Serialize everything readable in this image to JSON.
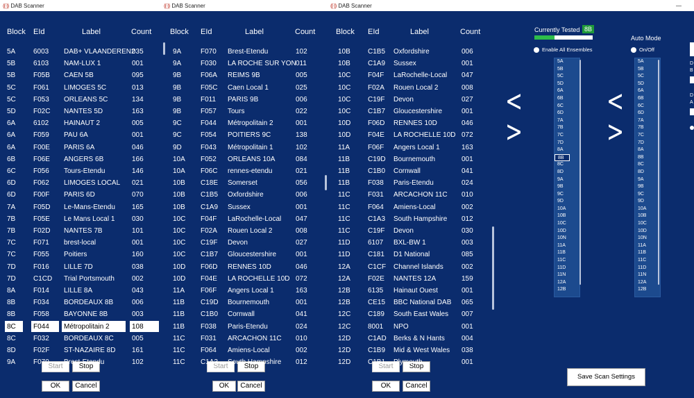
{
  "windows": [
    {
      "title": "DAB Scanner"
    },
    {
      "title": "DAB Scanner"
    },
    {
      "title": "DAB Scanner"
    }
  ],
  "window_minimize": "—",
  "logo_glyph": "((·))",
  "columns": {
    "block": "Block",
    "eid": "EId",
    "label": "Label",
    "count": "Count"
  },
  "panel1": [
    [
      "5A",
      "6003",
      "DAB+ VLAANDEREN2",
      "035"
    ],
    [
      "5B",
      "6103",
      "NAM-LUX 1",
      "001"
    ],
    [
      "5B",
      "F05B",
      "CAEN 5B",
      "095"
    ],
    [
      "5C",
      "F061",
      "LIMOGES 5C",
      "013"
    ],
    [
      "5C",
      "F053",
      "ORLEANS 5C",
      "134"
    ],
    [
      "5D",
      "F02C",
      "NANTES 5D",
      "163"
    ],
    [
      "6A",
      "6102",
      "HAINAUT 2",
      "005"
    ],
    [
      "6A",
      "F059",
      "PAU 6A",
      "001"
    ],
    [
      "6A",
      "F00E",
      "PARIS 6A",
      "046"
    ],
    [
      "6B",
      "F06E",
      "ANGERS 6B",
      "166"
    ],
    [
      "6C",
      "F056",
      "Tours-Etendu",
      "146"
    ],
    [
      "6D",
      "F062",
      "LIMOGES LOCAL",
      "021"
    ],
    [
      "6D",
      "F00F",
      "PARIS 6D",
      "070"
    ],
    [
      "7A",
      "F05D",
      "Le-Mans-Etendu",
      "165"
    ],
    [
      "7B",
      "F05E",
      "Le Mans Local 1",
      "030"
    ],
    [
      "7B",
      "F02D",
      "NANTES 7B",
      "101"
    ],
    [
      "7C",
      "F071",
      "brest-local",
      "001"
    ],
    [
      "7C",
      "F055",
      "Poitiers",
      "160"
    ],
    [
      "7D",
      "F016",
      "LILLE 7D",
      "038"
    ],
    [
      "7D",
      "C1CD",
      "Trial Portsmouth",
      "002"
    ],
    [
      "8A",
      "F014",
      "LILLE 8A",
      "043"
    ],
    [
      "8B",
      "F034",
      "BORDEAUX 8B",
      "006"
    ],
    [
      "8B",
      "F058",
      "BAYONNE 8B",
      "003"
    ],
    [
      "8C",
      "F044",
      "Métropolitain 2",
      "108"
    ],
    [
      "8C",
      "F032",
      "BORDEAUX 8C",
      "005"
    ],
    [
      "8D",
      "F02F",
      "ST-NAZAIRE 8D",
      "161"
    ],
    [
      "9A",
      "F070",
      "Brest-Etendu",
      "102"
    ]
  ],
  "panel2": [
    [
      "9A",
      "F070",
      "Brest-Etendu",
      "102"
    ],
    [
      "9A",
      "F030",
      "LA ROCHE SUR YON",
      "011"
    ],
    [
      "9B",
      "F06A",
      "REIMS 9B",
      "005"
    ],
    [
      "9B",
      "F05C",
      "Caen Local 1",
      "025"
    ],
    [
      "9B",
      "F011",
      "PARIS 9B",
      "006"
    ],
    [
      "9B",
      "F057",
      "Tours",
      "022"
    ],
    [
      "9C",
      "F044",
      "Métropolitain 2",
      "001"
    ],
    [
      "9C",
      "F054",
      "POITIERS 9C",
      "138"
    ],
    [
      "9D",
      "F043",
      "Métropolitain 1",
      "102"
    ],
    [
      "10A",
      "F052",
      "ORLEANS 10A",
      "084"
    ],
    [
      "10A",
      "F06C",
      "rennes-etendu",
      "021"
    ],
    [
      "10B",
      "C18E",
      "Somerset",
      "056"
    ],
    [
      "10B",
      "C1B5",
      "Oxfordshire",
      "006"
    ],
    [
      "10B",
      "C1A9",
      "Sussex",
      "001"
    ],
    [
      "10C",
      "F04F",
      "LaRochelle-Local",
      "047"
    ],
    [
      "10C",
      "F02A",
      "Rouen Local 2",
      "008"
    ],
    [
      "10C",
      "C19F",
      "Devon",
      "027"
    ],
    [
      "10C",
      "C1B7",
      "Gloucestershire",
      "001"
    ],
    [
      "10D",
      "F06D",
      "RENNES 10D",
      "046"
    ],
    [
      "10D",
      "F04E",
      "LA ROCHELLE 10D",
      "072"
    ],
    [
      "11A",
      "F06F",
      "Angers Local 1",
      "163"
    ],
    [
      "11B",
      "C19D",
      "Bournemouth",
      "001"
    ],
    [
      "11B",
      "C1B0",
      "Cornwall",
      "041"
    ],
    [
      "11B",
      "F038",
      "Paris-Etendu",
      "024"
    ],
    [
      "11C",
      "F031",
      "ARCACHON 11C",
      "010"
    ],
    [
      "11C",
      "F064",
      "Amiens-Local",
      "002"
    ],
    [
      "11C",
      "C1A3",
      "South Hampshire",
      "012"
    ]
  ],
  "panel3": [
    [
      "10B",
      "C1B5",
      "Oxfordshire",
      "006"
    ],
    [
      "10B",
      "C1A9",
      "Sussex",
      "001"
    ],
    [
      "10C",
      "F04F",
      "LaRochelle-Local",
      "047"
    ],
    [
      "10C",
      "F02A",
      "Rouen Local 2",
      "008"
    ],
    [
      "10C",
      "C19F",
      "Devon",
      "027"
    ],
    [
      "10C",
      "C1B7",
      "Gloucestershire",
      "001"
    ],
    [
      "10D",
      "F06D",
      "RENNES 10D",
      "046"
    ],
    [
      "10D",
      "F04E",
      "LA ROCHELLE 10D",
      "072"
    ],
    [
      "11A",
      "F06F",
      "Angers Local 1",
      "163"
    ],
    [
      "11B",
      "C19D",
      "Bournemouth",
      "001"
    ],
    [
      "11B",
      "C1B0",
      "Cornwall",
      "041"
    ],
    [
      "11B",
      "F038",
      "Paris-Etendu",
      "024"
    ],
    [
      "11C",
      "F031",
      "ARCACHON 11C",
      "010"
    ],
    [
      "11C",
      "F064",
      "Amiens-Local",
      "002"
    ],
    [
      "11C",
      "C1A3",
      "South Hampshire",
      "012"
    ],
    [
      "11C",
      "C19F",
      "Devon",
      "030"
    ],
    [
      "11D",
      "6107",
      "BXL-BW 1",
      "003"
    ],
    [
      "11D",
      "C181",
      "D1 National",
      "085"
    ],
    [
      "12A",
      "C1CF",
      "Channel Islands",
      "002"
    ],
    [
      "12A",
      "F02E",
      "NANTES 12A",
      "159"
    ],
    [
      "12B",
      "6135",
      "Hainaut Ouest",
      "001"
    ],
    [
      "12B",
      "CE15",
      "BBC National DAB",
      "065"
    ],
    [
      "12C",
      "C189",
      "South East Wales",
      "007"
    ],
    [
      "12C",
      "8001",
      "NPO",
      "001"
    ],
    [
      "12D",
      "C1AD",
      "Berks & N Hants",
      "004"
    ],
    [
      "12D",
      "C1B9",
      "Mid & West Wales",
      "038"
    ],
    [
      "12D",
      "C1B1",
      "Plymouth",
      "001"
    ]
  ],
  "buttons": {
    "start": "Start",
    "stop": "Stop",
    "ok": "OK",
    "cancel": "Cancel",
    "save": "Save Scan Settings"
  },
  "arrows": {
    "left": "<",
    "right": ">"
  },
  "settings": {
    "currently_tested_label": "Currently Tested",
    "currently_tested_value": "8B",
    "progress": 0.35,
    "enable_all": "Enable All Ensembles",
    "auto_mode": "Auto Mode",
    "on_off": "On/Off",
    "cut_d1": "D",
    "cut_b": "B",
    "cut_d2": "D",
    "cut_a": "A"
  },
  "blocks": [
    "5A",
    "5B",
    "5C",
    "5D",
    "6A",
    "6B",
    "6C",
    "6D",
    "7A",
    "7B",
    "7C",
    "7D",
    "8A",
    "8B",
    "8C",
    "8D",
    "9A",
    "9B",
    "9C",
    "9D",
    "10A",
    "10B",
    "10C",
    "10D",
    "10N",
    "11A",
    "11B",
    "11C",
    "11D",
    "11N",
    "12A",
    "12B"
  ],
  "blocks_selected": "8B"
}
